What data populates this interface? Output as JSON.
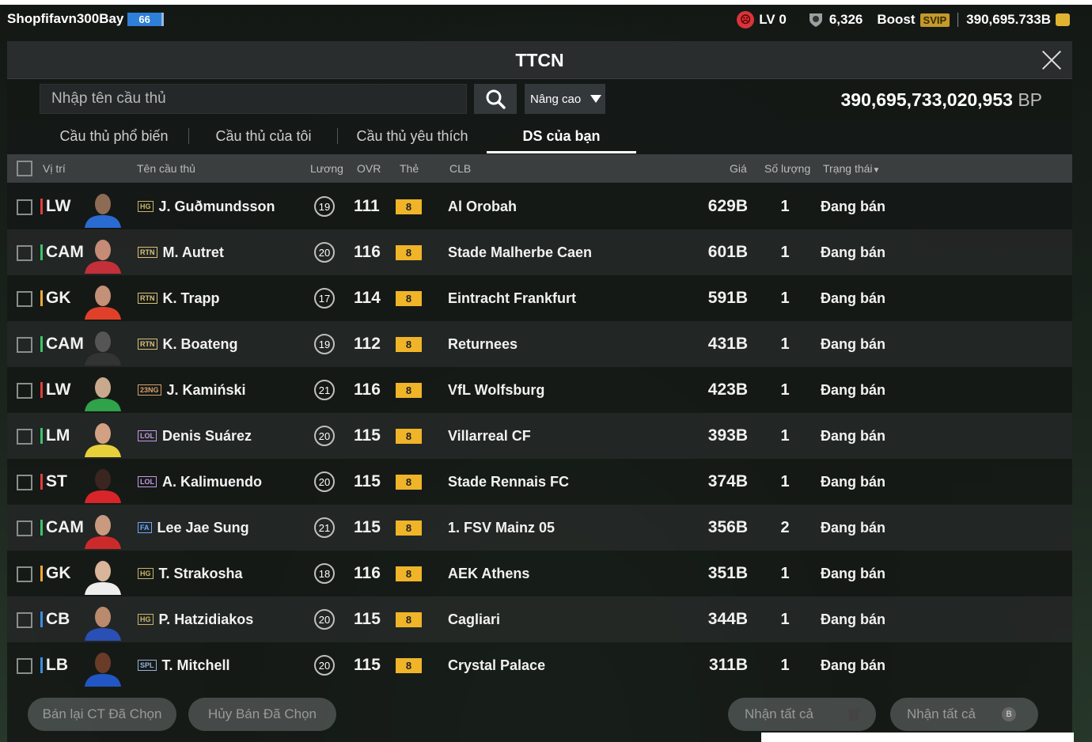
{
  "user": {
    "name": "Shopfifavn300Bay",
    "badge": "66"
  },
  "status": {
    "level": "LV 0",
    "rank_points": "6,326",
    "boost_label": "Boost",
    "svip": "SVIP",
    "coins": "390,695.733B"
  },
  "window": {
    "title": "TTCN"
  },
  "search": {
    "placeholder": "Nhập tên cầu thủ",
    "advanced_label": "Nâng cao"
  },
  "balance": {
    "value": "390,695,733,020,953",
    "unit": "BP"
  },
  "tabs": [
    {
      "label": "Cầu thủ phổ biến"
    },
    {
      "label": "Cầu thủ của tôi"
    },
    {
      "label": "Cầu thủ yêu thích"
    },
    {
      "label": "DS của bạn"
    }
  ],
  "columns": {
    "position": "Vị trí",
    "name": "Tên cầu thủ",
    "salary": "Lương",
    "ovr": "OVR",
    "card": "Thẻ",
    "club": "CLB",
    "price": "Giá",
    "quantity": "Số lượng",
    "status": "Trạng thái"
  },
  "rows": [
    {
      "pos": "LW",
      "pos_color": "#e23d3d",
      "season": "HG",
      "name": "J. Guðmundsson",
      "salary": "19",
      "ovr": "111",
      "card": "8",
      "club": "Al Orobah",
      "price": "629B",
      "qty": "1",
      "status": "Đang bán"
    },
    {
      "pos": "CAM",
      "pos_color": "#3ec46a",
      "season": "RTN",
      "name": "M. Autret",
      "salary": "20",
      "ovr": "116",
      "card": "8",
      "club": "Stade Malherbe Caen",
      "price": "601B",
      "qty": "1",
      "status": "Đang bán"
    },
    {
      "pos": "GK",
      "pos_color": "#f2a933",
      "season": "RTN",
      "name": "K. Trapp",
      "salary": "17",
      "ovr": "114",
      "card": "8",
      "club": "Eintracht Frankfurt",
      "price": "591B",
      "qty": "1",
      "status": "Đang bán"
    },
    {
      "pos": "CAM",
      "pos_color": "#3ec46a",
      "season": "RTN",
      "name": "K. Boateng",
      "salary": "19",
      "ovr": "112",
      "card": "8",
      "club": "Returnees",
      "price": "431B",
      "qty": "1",
      "status": "Đang bán"
    },
    {
      "pos": "LW",
      "pos_color": "#e23d3d",
      "season": "23NG",
      "name": "J. Kamiński",
      "salary": "21",
      "ovr": "116",
      "card": "8",
      "club": "VfL Wolfsburg",
      "price": "423B",
      "qty": "1",
      "status": "Đang bán"
    },
    {
      "pos": "LM",
      "pos_color": "#3ec46a",
      "season": "LOL",
      "name": "Denis Suárez",
      "salary": "20",
      "ovr": "115",
      "card": "8",
      "club": "Villarreal CF",
      "price": "393B",
      "qty": "1",
      "status": "Đang bán"
    },
    {
      "pos": "ST",
      "pos_color": "#e23d3d",
      "season": "LOL",
      "name": "A. Kalimuendo",
      "salary": "20",
      "ovr": "115",
      "card": "8",
      "club": "Stade Rennais FC",
      "price": "374B",
      "qty": "1",
      "status": "Đang bán"
    },
    {
      "pos": "CAM",
      "pos_color": "#3ec46a",
      "season": "FA",
      "name": "Lee Jae Sung",
      "salary": "21",
      "ovr": "115",
      "card": "8",
      "club": "1. FSV Mainz 05",
      "price": "356B",
      "qty": "2",
      "status": "Đang bán"
    },
    {
      "pos": "GK",
      "pos_color": "#f2a933",
      "season": "HG",
      "name": "T. Strakosha",
      "salary": "18",
      "ovr": "116",
      "card": "8",
      "club": "AEK Athens",
      "price": "351B",
      "qty": "1",
      "status": "Đang bán"
    },
    {
      "pos": "CB",
      "pos_color": "#3c8fe0",
      "season": "HG",
      "name": "P. Hatzidiakos",
      "salary": "20",
      "ovr": "115",
      "card": "8",
      "club": "Cagliari",
      "price": "344B",
      "qty": "1",
      "status": "Đang bán"
    },
    {
      "pos": "LB",
      "pos_color": "#3c8fe0",
      "season": "SPL",
      "name": "T. Mitchell",
      "salary": "20",
      "ovr": "115",
      "card": "8",
      "club": "Crystal Palace",
      "price": "311B",
      "qty": "1",
      "status": "Đang bán"
    }
  ],
  "footer": {
    "resell": "Bán lại CT Đã Chọn",
    "cancel": "Hủy Bán Đã Chọn",
    "claim_all_1": "Nhận tất cả",
    "claim_all_2": "Nhận tất cả",
    "coin_badge": "B"
  },
  "season_colors": {
    "HG": "#c8b46a",
    "RTN": "#d9c07a",
    "23NG": "#d8a070",
    "LOL": "#c59be6",
    "FA": "#6fa6ff",
    "SPL": "#9ab3d9"
  },
  "face_colors": [
    "#8e6b55",
    "#c58b76",
    "#c49078",
    "#555",
    "#c9a98e",
    "#d2a082",
    "#3a2520",
    "#c99a80",
    "#d9b59a",
    "#b98a6e",
    "#6a3c28"
  ],
  "shirt_colors": [
    "#2a6bd1",
    "#c3303a",
    "#e0402a",
    "#333",
    "#2fa24a",
    "#e8d03a",
    "#d8252a",
    "#cc2a2a",
    "#eeeeee",
    "#2a4fb5",
    "#2256c4"
  ]
}
